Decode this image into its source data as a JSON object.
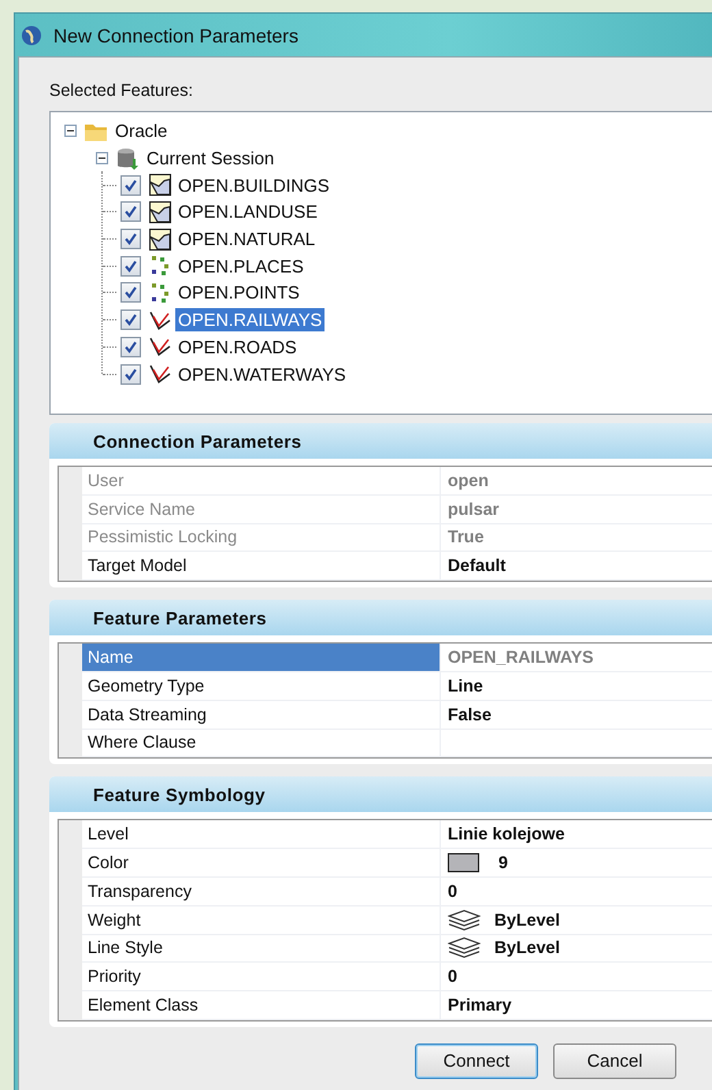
{
  "window": {
    "title": "New Connection Parameters"
  },
  "features_label": "Selected Features:",
  "tree": [
    {
      "label": "Oracle",
      "kind": "folder",
      "expanded": true,
      "children": [
        {
          "label": "Current Session",
          "kind": "database",
          "expanded": true,
          "children": [
            {
              "label": "OPEN.BUILDINGS",
              "kind": "polygon",
              "checked": true,
              "selected": false
            },
            {
              "label": "OPEN.LANDUSE",
              "kind": "polygon",
              "checked": true,
              "selected": false
            },
            {
              "label": "OPEN.NATURAL",
              "kind": "polygon",
              "checked": true,
              "selected": false
            },
            {
              "label": "OPEN.PLACES",
              "kind": "point",
              "checked": true,
              "selected": false
            },
            {
              "label": "OPEN.POINTS",
              "kind": "point",
              "checked": true,
              "selected": false
            },
            {
              "label": "OPEN.RAILWAYS",
              "kind": "line",
              "checked": true,
              "selected": true
            },
            {
              "label": "OPEN.ROADS",
              "kind": "line",
              "checked": true,
              "selected": false
            },
            {
              "label": "OPEN.WATERWAYS",
              "kind": "line",
              "checked": true,
              "selected": false
            }
          ]
        }
      ]
    }
  ],
  "sections": [
    {
      "title": "Connection Parameters",
      "rows": [
        {
          "label": "User",
          "value": "open",
          "kind": "text",
          "disabled": true,
          "readonly": true,
          "selected": false
        },
        {
          "label": "Service Name",
          "value": "pulsar",
          "kind": "text",
          "disabled": true,
          "readonly": true,
          "selected": false
        },
        {
          "label": "Pessimistic Locking",
          "value": "True",
          "kind": "text",
          "disabled": true,
          "readonly": true,
          "selected": false
        },
        {
          "label": "Target Model",
          "value": "Default",
          "kind": "text",
          "disabled": false,
          "readonly": false,
          "selected": false
        }
      ]
    },
    {
      "title": "Feature Parameters",
      "rows": [
        {
          "label": "Name",
          "value": "OPEN_RAILWAYS",
          "kind": "text",
          "disabled": false,
          "readonly": true,
          "selected": true
        },
        {
          "label": "Geometry Type",
          "value": "Line",
          "kind": "text",
          "disabled": false,
          "readonly": false,
          "selected": false
        },
        {
          "label": "Data Streaming",
          "value": "False",
          "kind": "text",
          "disabled": false,
          "readonly": false,
          "selected": false
        },
        {
          "label": "Where Clause",
          "kind": "text",
          "disabled": false,
          "selected": false
        }
      ]
    },
    {
      "title": "Feature Symbology",
      "rows": [
        {
          "label": "Level",
          "value": "Linie kolejowe",
          "kind": "text",
          "disabled": false,
          "readonly": false,
          "selected": false
        },
        {
          "label": "Color",
          "value": "9",
          "kind": "color",
          "color": "#b4b4b8",
          "disabled": false,
          "readonly": false,
          "selected": false
        },
        {
          "label": "Transparency",
          "value": "0",
          "kind": "text",
          "disabled": false,
          "readonly": false,
          "selected": false
        },
        {
          "label": "Weight",
          "value": "ByLevel",
          "kind": "symbol",
          "disabled": false,
          "readonly": false,
          "selected": false
        },
        {
          "label": "Line Style",
          "value": "ByLevel",
          "kind": "symbol",
          "disabled": false,
          "readonly": false,
          "selected": false
        },
        {
          "label": "Priority",
          "value": "0",
          "kind": "text",
          "disabled": false,
          "readonly": false,
          "selected": false
        },
        {
          "label": "Element Class",
          "value": "Primary",
          "kind": "text",
          "disabled": false,
          "readonly": false,
          "selected": false
        }
      ]
    }
  ],
  "buttons": [
    {
      "label": "Connect",
      "default": true
    },
    {
      "label": "Cancel",
      "default": false
    }
  ]
}
